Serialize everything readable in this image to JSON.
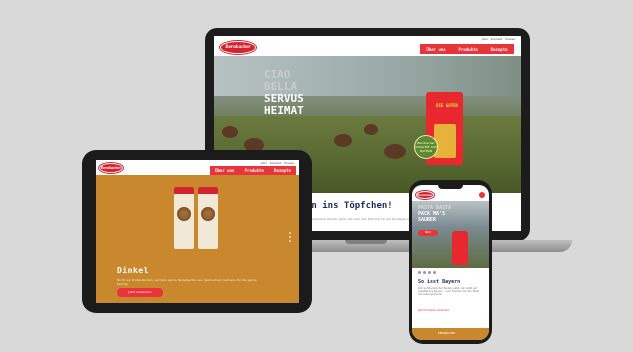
{
  "colors": {
    "brand_red": "#e8353b",
    "navy": "#1e2a5a",
    "mustard": "#c9882e",
    "background": "#d9d9d9"
  },
  "laptop": {
    "logo": "Bernbacher",
    "top_links": [
      "Jobs",
      "Kontakt",
      "Presse"
    ],
    "nav": [
      "Über uns",
      "Produkte",
      "Rezepte"
    ],
    "hero_lines": [
      "CIAO",
      "BELLA",
      "SERVUS",
      "HEIMAT"
    ],
    "pack_label": "DIE GUTEN",
    "badge": "Bernbacher QUALITÄT AUS BAYERN",
    "sub_heading": "en ins Töpfchen!",
    "sub_text": "…Bernbacher Nudeln geht, hat man den Kopf frei für die wichtigen Dinge im Leben"
  },
  "tablet": {
    "logo": "Bernbacher",
    "top_links": [
      "Jobs",
      "Kontakt",
      "Presse"
    ],
    "nav": [
      "Über uns",
      "Produkte",
      "Rezepte"
    ],
    "title": "Dinkel",
    "text": "Nicht nur Dinkel-Nudeln, sondern ganze Nudelwelten aus heimischem Getreide für die ganze Familie.",
    "button": "Jetzt entdecken"
  },
  "phone": {
    "logo": "Bernbacher",
    "hero_lines": [
      "PASTA BASTA",
      "PACK MA'S",
      "SAUBER"
    ],
    "button": "Mehr",
    "title": "So isst Bayern",
    "text": "Wer auf Bernbacher Nudeln setzt, der setzt auf Qualität aus Bayern – vom Feld bis auf den Teller, mit Liebe gemacht.",
    "link": "Jetzt Produkte entdecken",
    "footer": "BERNBACHER"
  }
}
